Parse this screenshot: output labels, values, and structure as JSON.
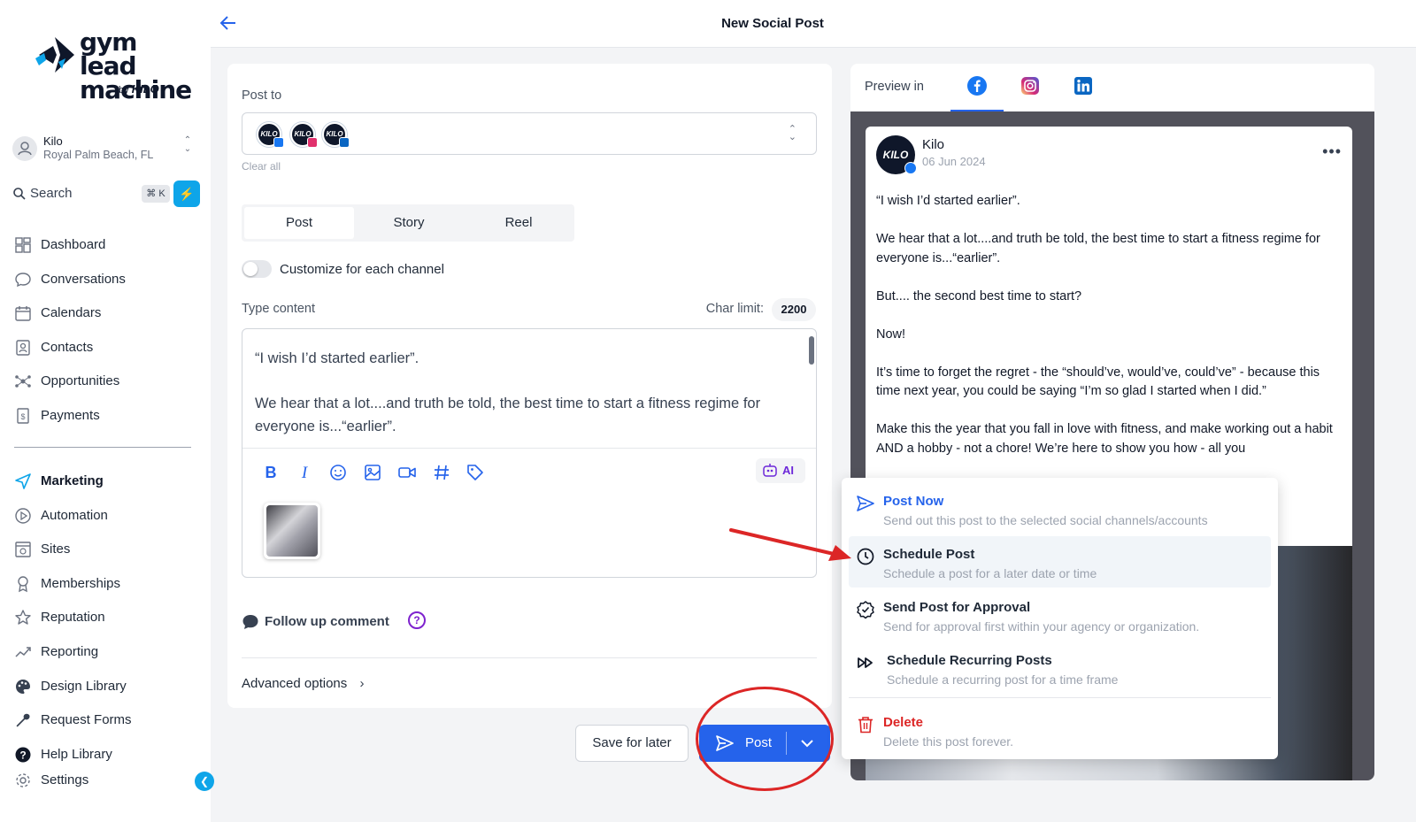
{
  "brand": {
    "line1": "gym lead",
    "line2": "machine",
    "by": "by",
    "by_brand": "KILO"
  },
  "location": {
    "name": "Kilo",
    "address": "Royal Palm Beach, FL"
  },
  "search": {
    "label": "Search",
    "shortcut": "⌘ K"
  },
  "nav_main": [
    {
      "label": "Dashboard",
      "icon": "dashboard-icon"
    },
    {
      "label": "Conversations",
      "icon": "chat-bubble-icon"
    },
    {
      "label": "Calendars",
      "icon": "calendar-icon"
    },
    {
      "label": "Contacts",
      "icon": "contacts-icon"
    },
    {
      "label": "Opportunities",
      "icon": "opportunities-icon"
    },
    {
      "label": "Payments",
      "icon": "payments-icon"
    }
  ],
  "nav_secondary": [
    {
      "label": "Marketing",
      "icon": "send-icon",
      "active": true
    },
    {
      "label": "Automation",
      "icon": "automation-icon"
    },
    {
      "label": "Sites",
      "icon": "sites-icon"
    },
    {
      "label": "Memberships",
      "icon": "award-icon"
    },
    {
      "label": "Reputation",
      "icon": "star-icon"
    },
    {
      "label": "Reporting",
      "icon": "trend-icon"
    },
    {
      "label": "Design Library",
      "icon": "palette-icon"
    },
    {
      "label": "Request Forms",
      "icon": "wrench-icon"
    },
    {
      "label": "Help Library",
      "icon": "help-icon"
    },
    {
      "label": "Settings",
      "icon": "gear-icon"
    }
  ],
  "header": {
    "title": "New Social Post"
  },
  "editor": {
    "post_to_label": "Post to",
    "accounts": [
      {
        "badge": "facebook",
        "color": "#1877f2"
      },
      {
        "badge": "instagram",
        "color": "#e1306c"
      },
      {
        "badge": "linkedin",
        "color": "#0a66c2"
      }
    ],
    "account_logo_text": "KILO",
    "clear_all": "Clear all",
    "tabs": [
      "Post",
      "Story",
      "Reel"
    ],
    "active_tab": "Post",
    "customize_label": "Customize for each channel",
    "customize_on": false,
    "type_content_label": "Type content",
    "char_limit_label": "Char limit:",
    "char_limit_value": "2200",
    "content_lines": [
      "“I wish I’d started earlier”.",
      "We hear that a lot....and truth be told, the best time to start a fitness regime for everyone is...“earlier”."
    ],
    "ai_label": "AI",
    "follow_up_label": "Follow up comment",
    "advanced_label": "Advanced options"
  },
  "actions": {
    "save_label": "Save for later",
    "post_label": "Post"
  },
  "preview": {
    "label": "Preview in",
    "tabs": [
      "facebook",
      "instagram",
      "linkedin"
    ],
    "active_tab": "facebook",
    "page_name": "Kilo",
    "date": "06 Jun 2024",
    "avatar_text": "KILO",
    "paragraphs": [
      "“I wish I’d started earlier”.",
      "We hear that a lot....and truth be told, the best time to start a fitness regime for everyone is...“earlier”.",
      "But.... the second best time to start?",
      "Now!",
      "It’s time to forget the regret - the “should’ve, would’ve, could’ve” - because this time next year, you could be saying “I’m so glad I started when I did.”",
      "Make this the year that you fall in love with fitness, and make working out a habit AND a hobby - not a chore! We’re here to show you how - all you"
    ]
  },
  "post_menu": [
    {
      "title": "Post Now",
      "desc": "Send out this post to the selected social channels/accounts",
      "color": "#2563eb"
    },
    {
      "title": "Schedule Post",
      "desc": "Schedule a post for a later date or time",
      "color": "#1f2937",
      "highlighted": true
    },
    {
      "title": "Send Post for Approval",
      "desc": "Send for approval first within your agency or organization.",
      "color": "#1f2937"
    },
    {
      "title": "Schedule Recurring Posts",
      "desc": "Schedule a recurring post for a time frame",
      "color": "#1f2937"
    },
    {
      "title": "Delete",
      "desc": "Delete this post forever.",
      "color": "#dc2626"
    }
  ],
  "colors": {
    "accent": "#2563eb",
    "sky": "#0ea5e9",
    "danger": "#dc2626",
    "annotation": "#dc2626"
  }
}
